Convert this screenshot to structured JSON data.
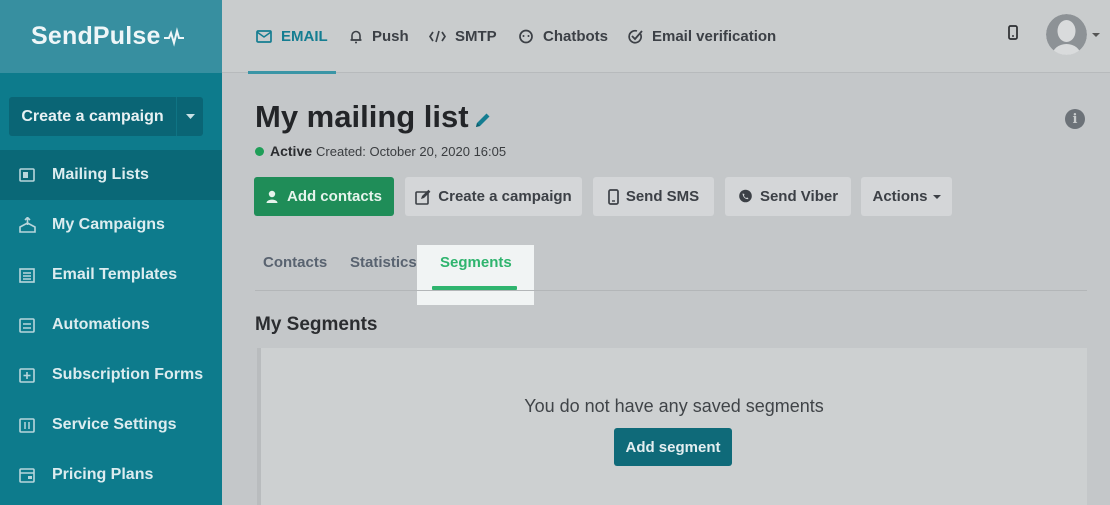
{
  "brand": {
    "name": "SendPulse"
  },
  "sidebar": {
    "create_button": "Create a campaign",
    "items": [
      {
        "label": "Mailing Lists",
        "icon": "mailing-list-icon"
      },
      {
        "label": "My Campaigns",
        "icon": "campaigns-icon"
      },
      {
        "label": "Email Templates",
        "icon": "templates-icon"
      },
      {
        "label": "Automations",
        "icon": "automations-icon"
      },
      {
        "label": "Subscription Forms",
        "icon": "forms-icon"
      },
      {
        "label": "Service Settings",
        "icon": "settings-icon"
      },
      {
        "label": "Pricing Plans",
        "icon": "pricing-icon"
      }
    ]
  },
  "topnav": {
    "tabs": [
      {
        "label": "EMAIL",
        "icon": "envelope-icon"
      },
      {
        "label": "Push",
        "icon": "bell-icon"
      },
      {
        "label": "SMTP",
        "icon": "code-icon"
      },
      {
        "label": "Chatbots",
        "icon": "chat-icon"
      },
      {
        "label": "Email verification",
        "icon": "check-circle-icon"
      }
    ]
  },
  "page": {
    "title": "My mailing list",
    "status": "Active",
    "created": "Created: October 20, 2020 16:05",
    "actions": {
      "add_contacts": "Add contacts",
      "create_campaign": "Create a campaign",
      "send_sms": "Send SMS",
      "send_viber": "Send Viber",
      "more": "Actions"
    },
    "tabs": {
      "contacts": "Contacts",
      "statistics": "Statistics",
      "segments": "Segments"
    },
    "segments": {
      "heading": "My Segments",
      "empty": "You do not have any saved segments",
      "add_button": "Add segment"
    }
  },
  "colors": {
    "sidebar": "#0d7b8c",
    "accent_green": "#2fb46e",
    "button_green": "#1f8d58"
  }
}
